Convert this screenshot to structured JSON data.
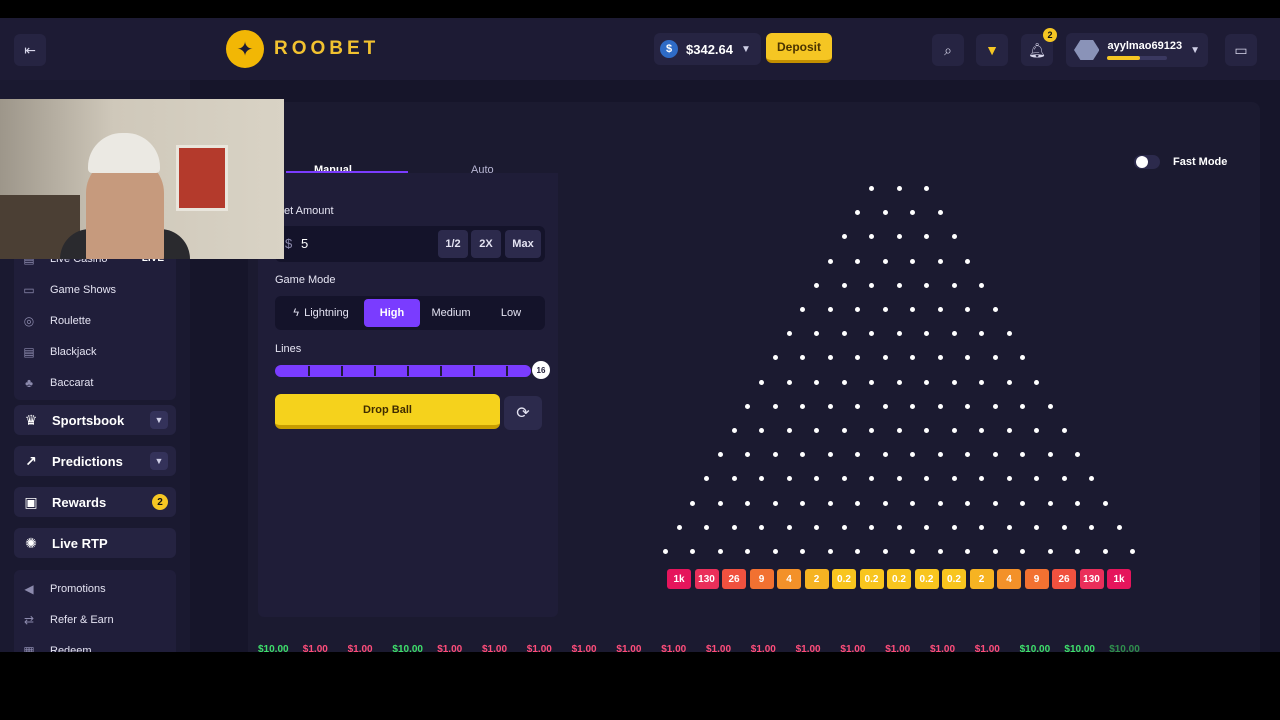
{
  "header": {
    "brand": "ROOBET",
    "balance": "$342.64",
    "deposit_label": "Deposit",
    "notification_count": "2",
    "username": "ayylmao69123"
  },
  "sidebar": {
    "casino_items": [
      {
        "label": "Live Casino",
        "badge": "LIVE",
        "icon": "cards-icon"
      },
      {
        "label": "Game Shows",
        "badge": "",
        "icon": "tv-icon"
      },
      {
        "label": "Roulette",
        "badge": "",
        "icon": "roulette-icon"
      },
      {
        "label": "Blackjack",
        "badge": "",
        "icon": "cards-icon"
      },
      {
        "label": "Baccarat",
        "badge": "",
        "icon": "club-icon"
      }
    ],
    "sportsbook": "Sportsbook",
    "predictions": "Predictions",
    "rewards": "Rewards",
    "rewards_count": "2",
    "live_rtp": "Live RTP",
    "misc_items": [
      {
        "label": "Promotions",
        "icon": "megaphone-icon"
      },
      {
        "label": "Refer & Earn",
        "icon": "share-icon"
      },
      {
        "label": "Redeem",
        "icon": "ticket-icon"
      }
    ]
  },
  "game": {
    "tabs": [
      "Manual",
      "Auto"
    ],
    "active_tab": "Manual",
    "bet_label": "et Amount",
    "bet_currency": "$",
    "bet_value": "5",
    "bet_buttons": [
      "1/2",
      "2X",
      "Max"
    ],
    "mode_label": "Game Mode",
    "modes": [
      "Lightning",
      "High",
      "Medium",
      "Low"
    ],
    "active_mode": "High",
    "lines_label": "Lines",
    "lines_value": "16",
    "drop_label": "Drop Ball",
    "fast_mode_label": "Fast Mode",
    "fast_mode_on": false,
    "buckets": [
      "1k",
      "130",
      "26",
      "9",
      "4",
      "2",
      "0.2",
      "0.2",
      "0.2",
      "0.2",
      "0.2",
      "2",
      "4",
      "9",
      "26",
      "130",
      "1k"
    ],
    "bucket_colors": [
      "#e5155c",
      "#ea2f5a",
      "#f0513f",
      "#f27131",
      "#f39129",
      "#f6b322",
      "#f8c51e",
      "#f8c51e",
      "#f8c51e",
      "#f8c51e",
      "#f8c51e",
      "#f6b322",
      "#f39129",
      "#f27131",
      "#f0513f",
      "#ea2f5a",
      "#e5155c"
    ],
    "rows": 16
  },
  "history": [
    {
      "v": "$10.00",
      "c": "#3ee06b"
    },
    {
      "v": "$1.00",
      "c": "#ff4d7a"
    },
    {
      "v": "$1.00",
      "c": "#ff4d7a"
    },
    {
      "v": "$10.00",
      "c": "#3ee06b"
    },
    {
      "v": "$1.00",
      "c": "#ff4d7a"
    },
    {
      "v": "$1.00",
      "c": "#ff4d7a"
    },
    {
      "v": "$1.00",
      "c": "#ff4d7a"
    },
    {
      "v": "$1.00",
      "c": "#ff4d7a"
    },
    {
      "v": "$1.00",
      "c": "#ff4d7a"
    },
    {
      "v": "$1.00",
      "c": "#ff4d7a"
    },
    {
      "v": "$1.00",
      "c": "#ff4d7a"
    },
    {
      "v": "$1.00",
      "c": "#ff4d7a"
    },
    {
      "v": "$1.00",
      "c": "#ff4d7a"
    },
    {
      "v": "$1.00",
      "c": "#ff4d7a"
    },
    {
      "v": "$1.00",
      "c": "#ff4d7a"
    },
    {
      "v": "$1.00",
      "c": "#ff4d7a"
    },
    {
      "v": "$1.00",
      "c": "#ff4d7a"
    },
    {
      "v": "$10.00",
      "c": "#3ee06b"
    },
    {
      "v": "$10.00",
      "c": "#3ee06b"
    },
    {
      "v": "$10.00",
      "c": "#2f8f4c"
    }
  ]
}
